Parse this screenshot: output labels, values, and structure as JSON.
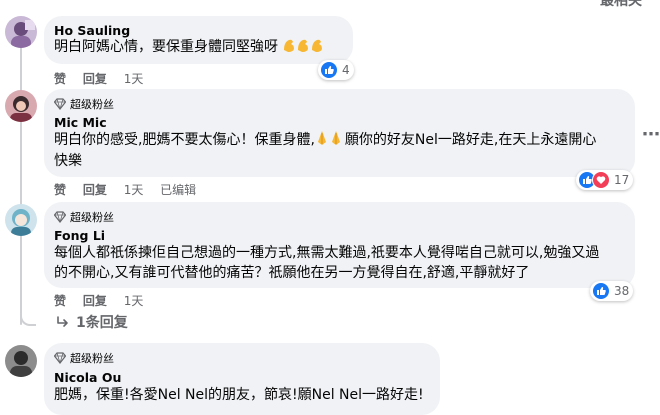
{
  "sort_label": "最相关",
  "actions": {
    "like": "赞",
    "reply": "回复",
    "edited": "已编辑"
  },
  "comments": [
    {
      "name": "Ho Sauling",
      "lines": [
        "明白阿媽心情，要保重身體同堅強呀"
      ],
      "emoji_after": "flexed-biceps-emoji x3",
      "time": "1天",
      "reactions": {
        "icons": [
          "like"
        ],
        "count": "4"
      }
    },
    {
      "badge": "超级粉丝",
      "name": "Mic Mic",
      "line1_a": "明白你的感受,肥媽不要太傷心！保重身體,",
      "line1_b": "願你的好友Nel一路好走,在天上永遠開心",
      "line2": "快樂",
      "emoji_mid": "folded-hands-emoji x2",
      "time": "1天",
      "edited": true,
      "reactions": {
        "icons": [
          "like",
          "love"
        ],
        "count": "17"
      }
    },
    {
      "badge": "超级粉丝",
      "name": "Fong Li",
      "lines": [
        "每個人都祇係揀佢自己想過的一種方式,無需太難過,祇要本人覺得啱自己就可以,勉強又過",
        "的不開心,又有誰可代替他的痛苦？祇願他在另一方覺得自在,舒適,平靜就好了"
      ],
      "time": "1天",
      "reactions": {
        "icons": [
          "like"
        ],
        "count": "38"
      }
    },
    {
      "badge": "超级粉丝",
      "name": "Nicola Ou",
      "lines": [
        "肥媽，保重!各愛Nel Nel的朋友，節哀!願Nel Nel一路好走!"
      ]
    }
  ],
  "replies_link": "1条回复",
  "colors": {
    "bubble": "#f0f2f5",
    "like": "#1877f2",
    "love": "#f33e58",
    "meta": "#65676b"
  }
}
